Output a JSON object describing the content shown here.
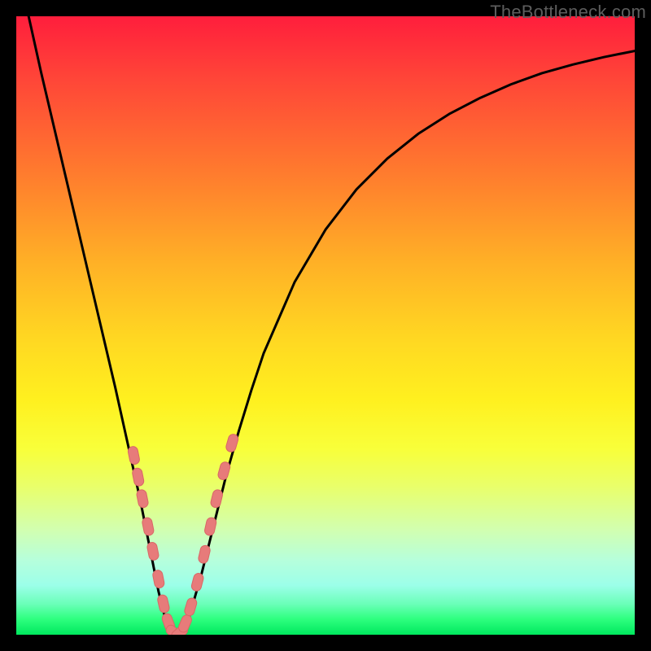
{
  "watermark": "TheBottleneck.com",
  "colors": {
    "frame": "#000000",
    "curve": "#000000",
    "marker_fill": "#e77b7a",
    "marker_stroke": "#d96766"
  },
  "chart_data": {
    "type": "line",
    "title": "",
    "xlabel": "",
    "ylabel": "",
    "xlim": [
      0,
      100
    ],
    "ylim": [
      0,
      100
    ],
    "grid": false,
    "legend": false,
    "annotations": [],
    "series": [
      {
        "name": "bottleneck-curve",
        "x": [
          0,
          2,
          4,
          6,
          8,
          10,
          12,
          14,
          16,
          18,
          20,
          21,
          22,
          23,
          24,
          25,
          26,
          27,
          28,
          30,
          32,
          34,
          36,
          38,
          40,
          45,
          50,
          55,
          60,
          65,
          70,
          75,
          80,
          85,
          90,
          95,
          100
        ],
        "y": [
          109,
          100,
          91,
          82.5,
          74,
          65.5,
          57,
          48.5,
          40,
          31,
          22,
          17,
          12,
          7,
          3,
          0.5,
          0,
          0.5,
          3,
          10,
          18,
          26,
          33,
          39.5,
          45.5,
          57,
          65.5,
          72,
          77,
          81,
          84.2,
          86.8,
          89,
          90.8,
          92.2,
          93.4,
          94.4
        ]
      }
    ],
    "markers": {
      "name": "highlighted-points",
      "shape": "rounded-pill",
      "points": [
        {
          "x": 19.0,
          "y": 29.0
        },
        {
          "x": 19.7,
          "y": 25.5
        },
        {
          "x": 20.4,
          "y": 22.0
        },
        {
          "x": 21.3,
          "y": 17.5
        },
        {
          "x": 22.1,
          "y": 13.5
        },
        {
          "x": 23.0,
          "y": 9.0
        },
        {
          "x": 23.8,
          "y": 5.0
        },
        {
          "x": 24.6,
          "y": 2.0
        },
        {
          "x": 25.5,
          "y": 0.3
        },
        {
          "x": 26.4,
          "y": 0.3
        },
        {
          "x": 27.3,
          "y": 1.8
        },
        {
          "x": 28.2,
          "y": 4.5
        },
        {
          "x": 29.3,
          "y": 8.5
        },
        {
          "x": 30.4,
          "y": 13.0
        },
        {
          "x": 31.4,
          "y": 17.5
        },
        {
          "x": 32.4,
          "y": 22.0
        },
        {
          "x": 33.6,
          "y": 26.5
        },
        {
          "x": 34.9,
          "y": 31.0
        }
      ]
    }
  }
}
